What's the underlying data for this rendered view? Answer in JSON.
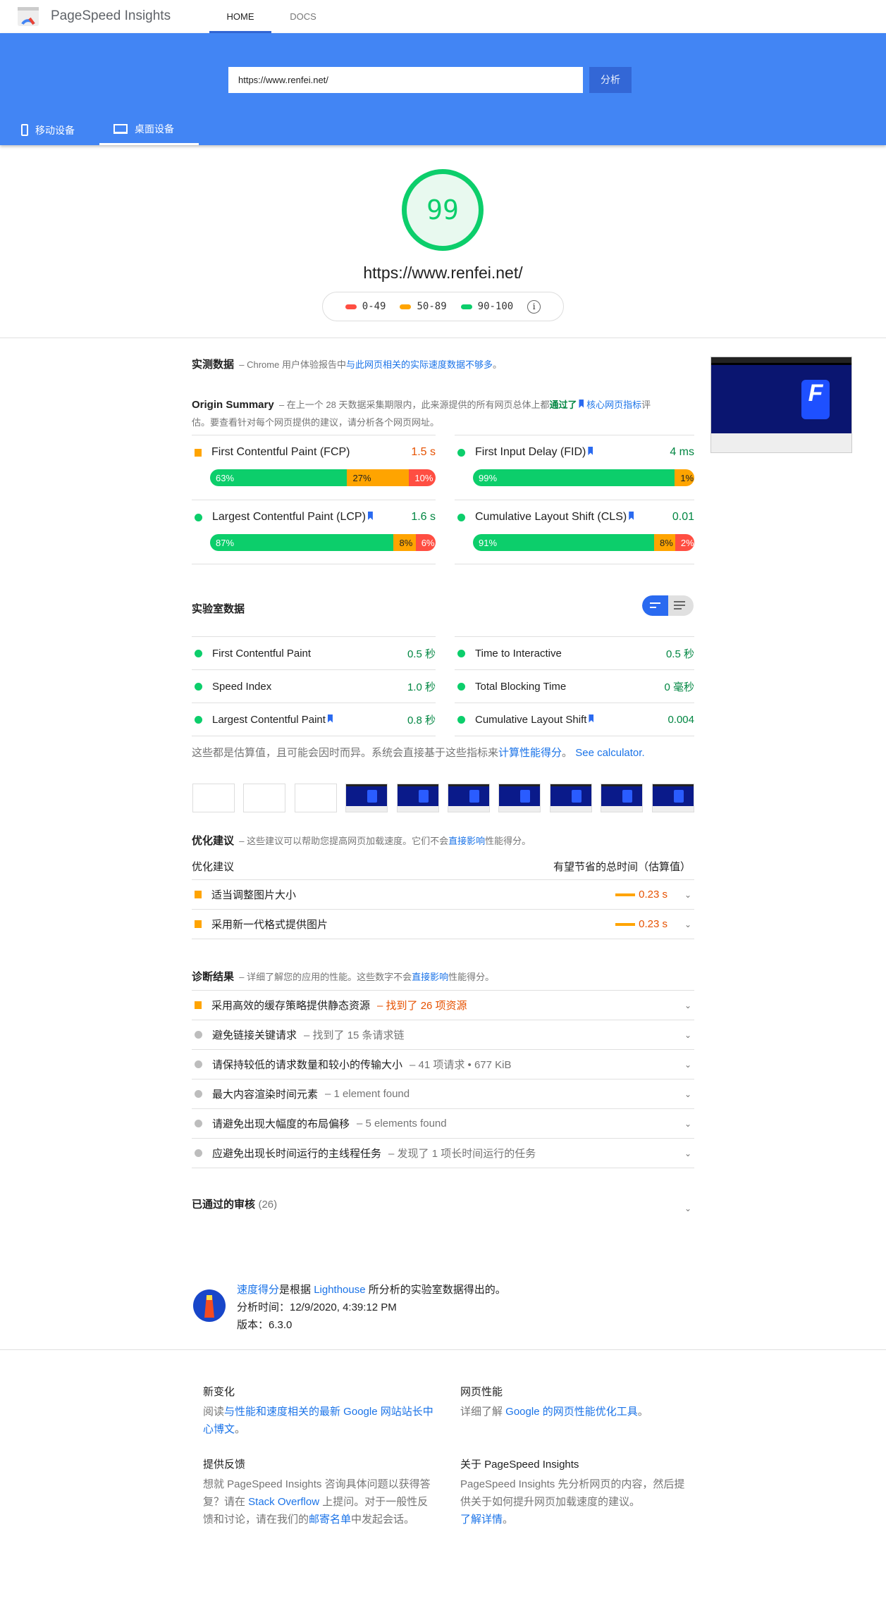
{
  "header": {
    "brand": "PageSpeed Insights",
    "nav": [
      {
        "label": "HOME",
        "active": true
      },
      {
        "label": "DOCS",
        "active": false
      }
    ]
  },
  "search": {
    "url_value": "https://www.renfei.net/",
    "analyze_label": "分析"
  },
  "device_tabs": [
    {
      "label": "移动设备",
      "icon": "phone-icon",
      "active": false
    },
    {
      "label": "桌面设备",
      "icon": "laptop-icon",
      "active": true
    }
  ],
  "score": {
    "value": "99",
    "url": "https://www.renfei.net/",
    "color": "#0cce6b",
    "legend": [
      {
        "label": "0-49",
        "color": "#ff4e42"
      },
      {
        "label": "50-89",
        "color": "#ffa400"
      },
      {
        "label": "90-100",
        "color": "#0cce6b"
      }
    ]
  },
  "field": {
    "title": "实测数据",
    "desc_prefix": "– Chrome 用户体验报告中",
    "desc_link": "与此网页相关的实际速度数据不够多",
    "desc_suffix": "。",
    "origin_title": "Origin Summary",
    "origin_pre": "– 在上一个 28 天数据采集期限内，此来源提供的所有网页总体上都",
    "origin_pass": "通过了",
    "origin_link": "核心网页指标",
    "origin_post": "评估。要查看针对每个网页提供的建议，请分析各个网页网址。",
    "metrics": [
      {
        "label": "First Contentful Paint (FCP)",
        "value": "1.5 s",
        "status": "average",
        "core": false,
        "dist": [
          "63%",
          "27%",
          "10%"
        ],
        "pct": [
          63,
          27,
          10
        ]
      },
      {
        "label": "First Input Delay (FID)",
        "value": "4 ms",
        "status": "fast",
        "core": true,
        "dist": [
          "99%",
          "1%",
          ""
        ],
        "pct": [
          99,
          1,
          0
        ]
      },
      {
        "label": "Largest Contentful Paint (LCP)",
        "value": "1.6 s",
        "status": "fast",
        "core": true,
        "dist": [
          "87%",
          "8%",
          "6%"
        ],
        "pct": [
          87,
          8,
          6
        ]
      },
      {
        "label": "Cumulative Layout Shift (CLS)",
        "value": "0.01",
        "status": "fast",
        "core": true,
        "dist": [
          "91%",
          "8%",
          "2%"
        ],
        "pct": [
          91,
          8,
          2
        ]
      }
    ]
  },
  "lab": {
    "title": "实验室数据",
    "metrics": [
      {
        "label": "First Contentful Paint",
        "value": "0.5 秒",
        "core": false
      },
      {
        "label": "Time to Interactive",
        "value": "0.5 秒",
        "core": false
      },
      {
        "label": "Speed Index",
        "value": "1.0 秒",
        "core": false
      },
      {
        "label": "Total Blocking Time",
        "value": "0 毫秒",
        "core": false
      },
      {
        "label": "Largest Contentful Paint",
        "value": "0.8 秒",
        "core": true
      },
      {
        "label": "Cumulative Layout Shift",
        "value": "0.004",
        "core": true
      }
    ],
    "note_prefix": "这些都是估算值，且可能会因时而异。系统会直接基于这些指标来",
    "note_link": "计算性能得分",
    "note_mid": "。",
    "note_calc": "See calculator."
  },
  "opportunities": {
    "title": "优化建议",
    "desc_pre": "– 这些建议可以帮助您提高网页加载速度。它们不会",
    "desc_link": "直接影响",
    "desc_post": "性能得分。",
    "col_left": "优化建议",
    "col_right": "有望节省的总时间（估算值）",
    "items": [
      {
        "label": "适当调整图片大小",
        "value": "0.23 s"
      },
      {
        "label": "采用新一代格式提供图片",
        "value": "0.23 s"
      }
    ]
  },
  "diagnostics": {
    "title": "诊断结果",
    "desc_pre": "– 详细了解您的应用的性能。这些数字不会",
    "desc_link": "直接影响",
    "desc_post": "性能得分。",
    "items": [
      {
        "label": "采用高效的缓存策略提供静态资源",
        "detail": "– 找到了 26 项资源",
        "warn": true
      },
      {
        "label": "避免链接关键请求",
        "detail": "– 找到了 15 条请求链",
        "warn": false
      },
      {
        "label": "请保持较低的请求数量和较小的传输大小",
        "detail": "– 41 项请求 • 677 KiB",
        "warn": false
      },
      {
        "label": "最大内容渲染时间元素",
        "detail": "– 1 element found",
        "warn": false
      },
      {
        "label": "请避免出现大幅度的布局偏移",
        "detail": "– 5 elements found",
        "warn": false
      },
      {
        "label": "应避免出现长时间运行的主线程任务",
        "detail": "– 发现了 1 项长时间运行的任务",
        "warn": false
      }
    ]
  },
  "passed": {
    "title": "已通过的审核",
    "count": "(26)"
  },
  "lighthouse": {
    "link1": "速度得分",
    "mid": "是根据 ",
    "link2": "Lighthouse",
    "post": " 所分析的实验室数据得出的。",
    "time": "分析时间：12/9/2020, 4:39:12 PM",
    "version": "版本：6.3.0"
  },
  "footer": {
    "whats_new": {
      "title": "新变化",
      "pre": "阅读",
      "link": "与性能和速度相关的最新 Google 网站站长中心博文",
      "post": "。"
    },
    "web_perf": {
      "title": "网页性能",
      "pre": "详细了解 ",
      "link": "Google 的网页性能优化工具",
      "post": "。"
    },
    "feedback": {
      "title": "提供反馈",
      "p1": "想就 PageSpeed Insights 咨询具体问题以获得答复？请在 ",
      "link1": "Stack Overflow",
      "p2": " 上提问。对于一般性反馈和讨论，请在我们的",
      "link2": "邮寄名单",
      "p3": "中发起会话。"
    },
    "about": {
      "title": "关于 PageSpeed Insights",
      "p": "PageSpeed Insights 先分析网页的内容，然后提供关于如何提升网页加载速度的建议。",
      "link": "了解详情",
      "post": "。"
    }
  }
}
